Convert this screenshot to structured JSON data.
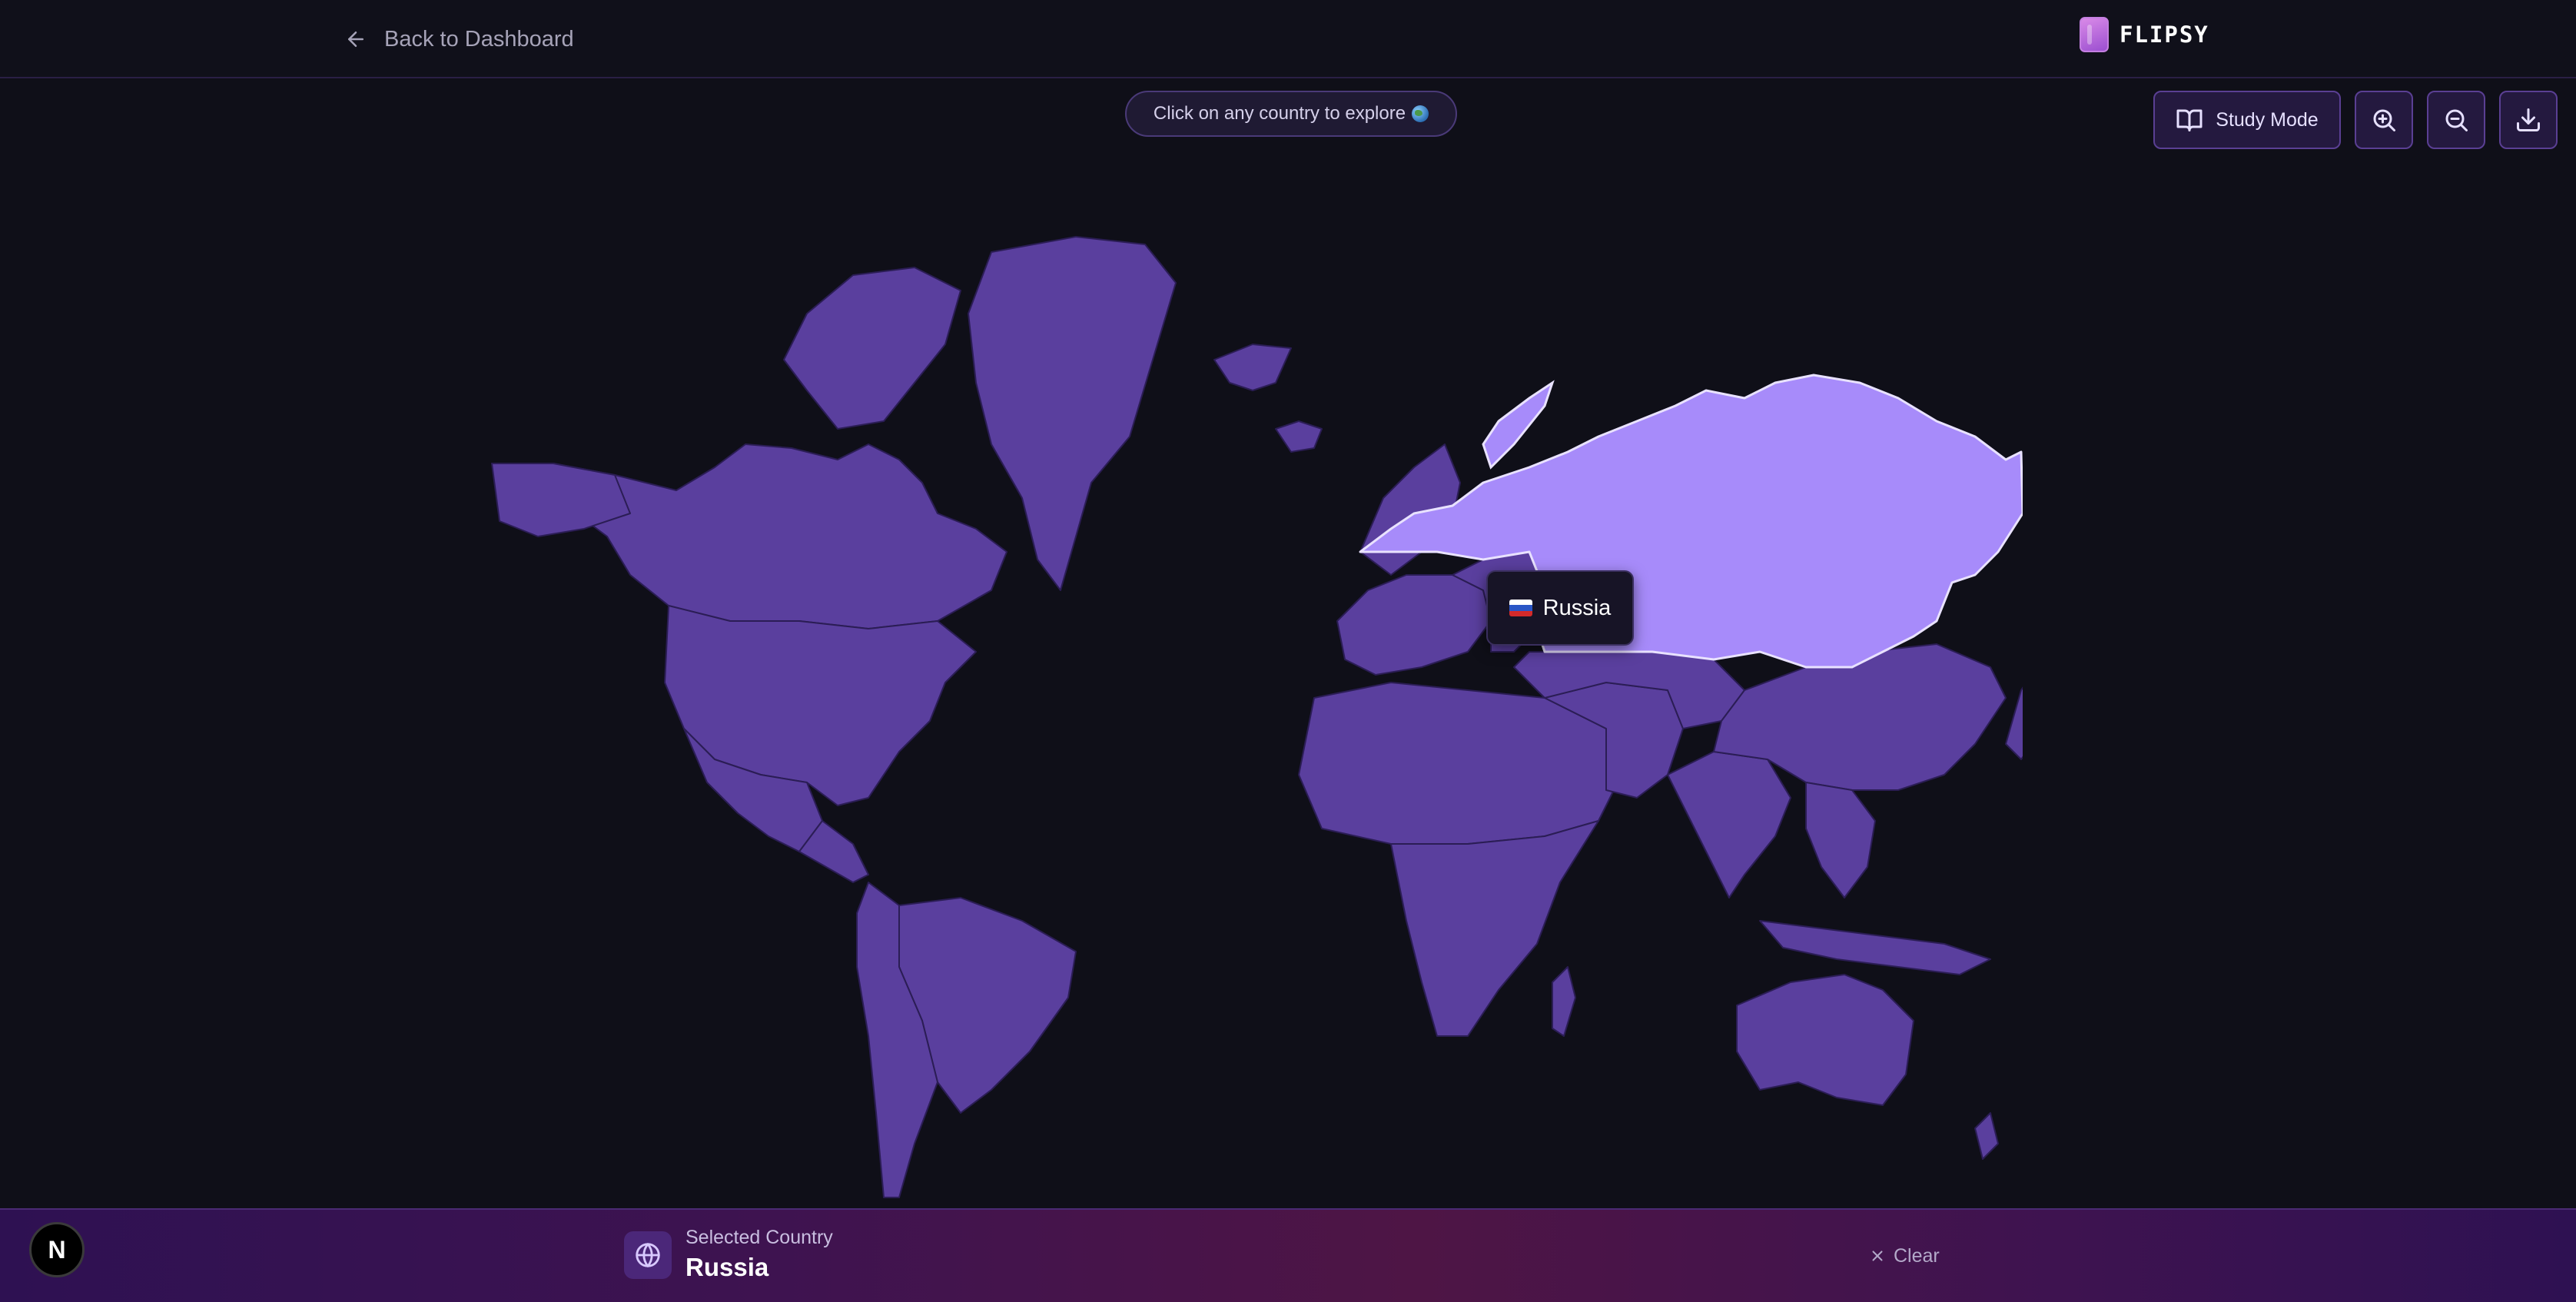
{
  "header": {
    "back_label": "Back to Dashboard",
    "brand_name": "FLIPSY"
  },
  "hint": {
    "text": "Click on any country to explore"
  },
  "controls": {
    "study_mode_label": "Study Mode",
    "zoom_in_icon": "zoom-in-icon",
    "zoom_out_icon": "zoom-out-icon",
    "download_icon": "download-icon"
  },
  "map": {
    "highlighted_country": "Russia",
    "tooltip_country": "Russia",
    "land_color": "#5a3f9e",
    "highlight_color": "#a78bfa",
    "border_color": "#2b1d55"
  },
  "footer": {
    "badge_letter": "N",
    "selected_caption": "Selected Country",
    "selected_value": "Russia",
    "clear_label": "Clear"
  }
}
